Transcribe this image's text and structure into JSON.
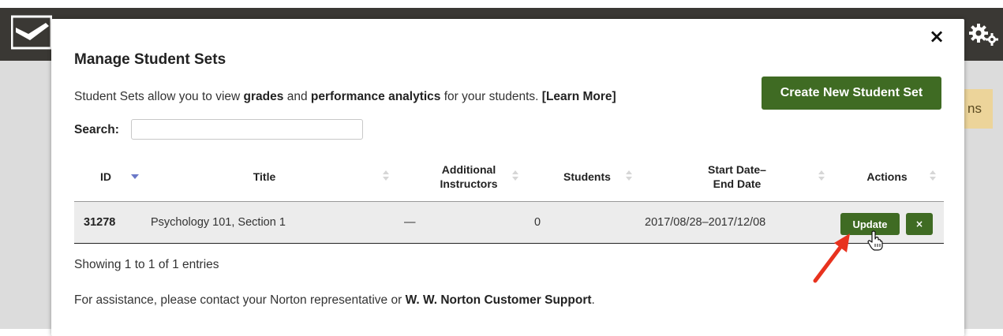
{
  "background": {
    "chip_text": "ns"
  },
  "modal": {
    "title": "Manage Student Sets",
    "close_label": "×",
    "intro": {
      "part1": "Student Sets allow you to view ",
      "bold1": "grades",
      "part2": " and ",
      "bold2": "performance analytics",
      "part3": " for your students. ",
      "link": "[Learn More]"
    },
    "create_button": "Create New Student Set",
    "search_label": "Search:",
    "search_value": "",
    "table": {
      "headers": [
        {
          "key": "id",
          "label": "ID"
        },
        {
          "key": "title",
          "label": "Title"
        },
        {
          "key": "instructors",
          "label": "Additional\nInstructors"
        },
        {
          "key": "students",
          "label": "Students"
        },
        {
          "key": "dates",
          "label": "Start Date–\nEnd Date"
        },
        {
          "key": "actions",
          "label": "Actions"
        }
      ],
      "rows": [
        {
          "id": "31278",
          "title": "Psychology 101, Section 1",
          "instructors": "—",
          "students": "0",
          "dates": "2017/08/28–2017/12/08",
          "update_label": "Update",
          "delete_label": "×"
        }
      ]
    },
    "showing": "Showing 1 to 1 of 1 entries",
    "assist": {
      "text": "For assistance, please contact your Norton representative or ",
      "link": "W. W. Norton Customer Support",
      "end": "."
    }
  },
  "colors": {
    "brand_green": "#3f6b23",
    "topbar": "#3a3834",
    "annotation_arrow": "#e8321e",
    "sort_active": "#6a78c8"
  },
  "icons": [
    "logo-icon",
    "gear-icon",
    "close-icon",
    "sort-icon",
    "sort-desc-icon",
    "annotation-arrow",
    "hand-cursor-icon"
  ]
}
